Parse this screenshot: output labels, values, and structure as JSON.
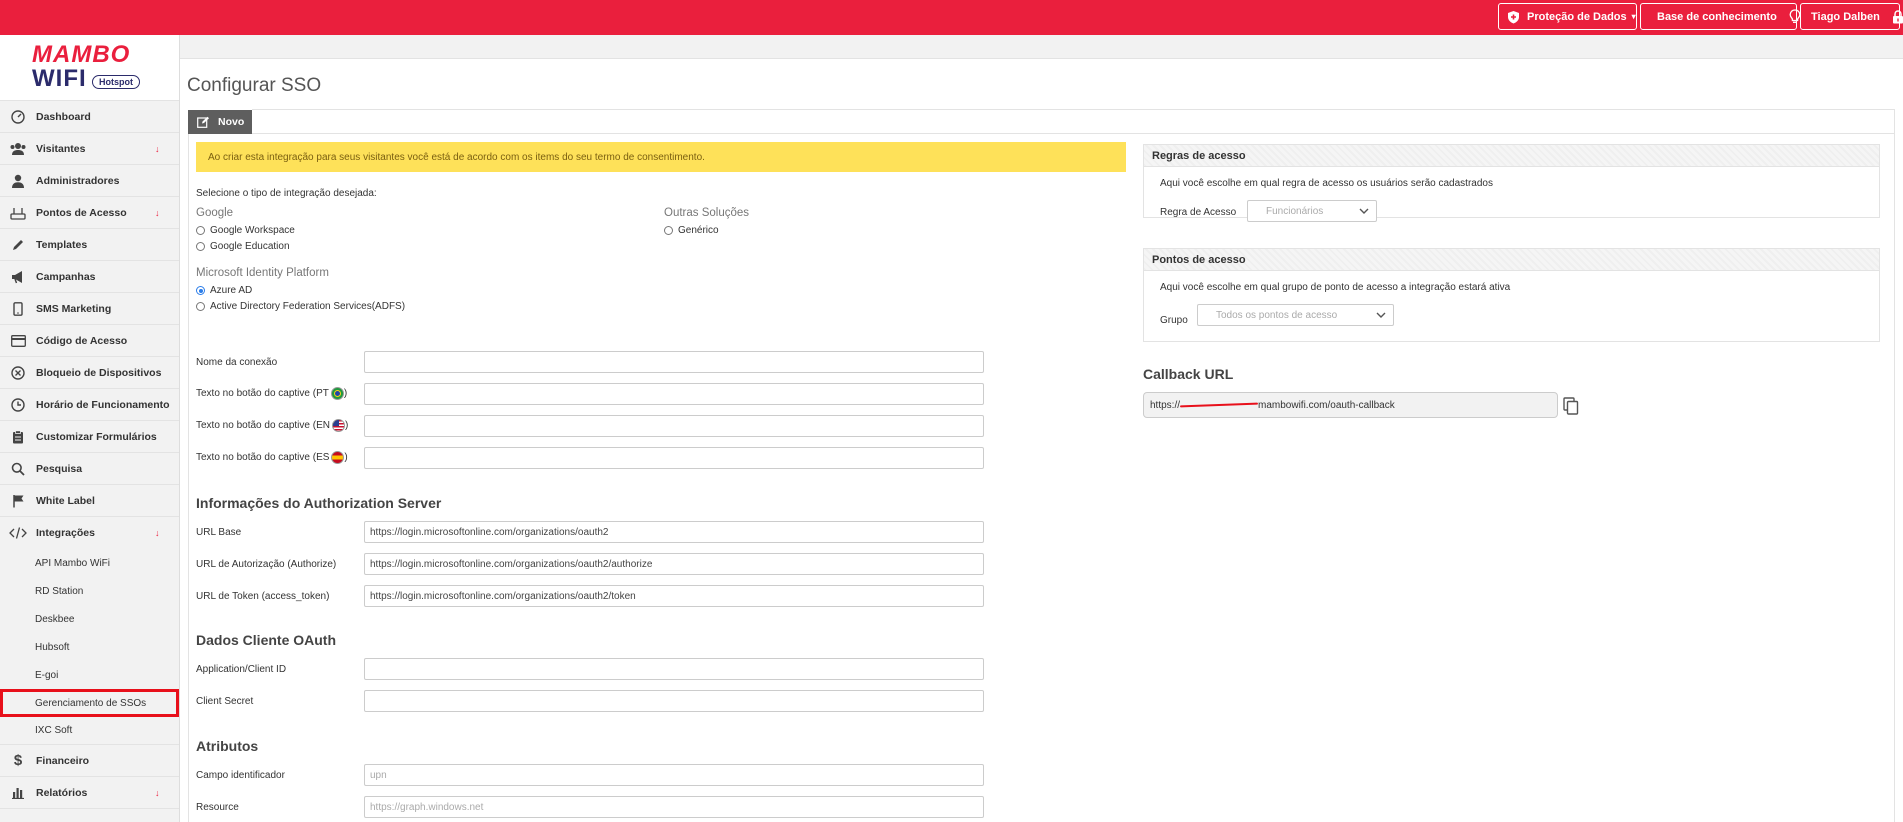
{
  "topbar": {
    "data_protection": "Proteção de Dados",
    "knowledge_base": "Base de conhecimento",
    "user": "Tiago Dalben"
  },
  "brand": {
    "line1": "MAMBO",
    "line2": "WIFI",
    "badge": "Hotspot"
  },
  "sidebar": {
    "items": [
      {
        "label": "Dashboard",
        "icon": "dashboard-icon"
      },
      {
        "label": "Visitantes",
        "icon": "users-icon",
        "arrow": "↓"
      },
      {
        "label": "Administradores",
        "icon": "user-icon"
      },
      {
        "label": "Pontos de Acesso",
        "icon": "router-icon",
        "arrow": "↓"
      },
      {
        "label": "Templates",
        "icon": "pencil-icon"
      },
      {
        "label": "Campanhas",
        "icon": "megaphone-icon"
      },
      {
        "label": "SMS Marketing",
        "icon": "phone-icon"
      },
      {
        "label": "Código de Acesso",
        "icon": "card-icon"
      },
      {
        "label": "Bloqueio de Dispositivos",
        "icon": "block-icon"
      },
      {
        "label": "Horário de Funcionamento",
        "icon": "clock-icon"
      },
      {
        "label": "Customizar Formulários",
        "icon": "clipboard-icon"
      },
      {
        "label": "Pesquisa",
        "icon": "search-icon"
      },
      {
        "label": "White Label",
        "icon": "flag-icon"
      },
      {
        "label": "Integrações",
        "icon": "code-icon",
        "arrow": "↓"
      }
    ],
    "subitems": [
      "API Mambo WiFi",
      "RD Station",
      "Deskbee",
      "Hubsoft",
      "E-goi",
      "Gerenciamento de SSOs",
      "IXC Soft"
    ],
    "bottom_items": [
      {
        "label": "Financeiro",
        "icon": "dollar-icon"
      },
      {
        "label": "Relatórios",
        "icon": "bar-chart-icon",
        "arrow": "↓"
      }
    ]
  },
  "page": {
    "title": "Configurar SSO",
    "tab": "Novo",
    "alert": "Ao criar esta integração para seus visitantes você está de acordo com os items do seu termo de consentimento.",
    "select_type": "Selecione o tipo de integração desejada:",
    "google": {
      "label": "Google",
      "options": [
        "Google Workspace",
        "Google Education"
      ]
    },
    "other": {
      "label": "Outras Soluções",
      "options": [
        "Genérico"
      ]
    },
    "microsoft": {
      "label": "Microsoft Identity Platform",
      "options": [
        "Azure AD",
        "Active Directory Federation Services(ADFS)"
      ],
      "selected": "Azure AD"
    }
  },
  "form": {
    "connection_name": "Nome da conexão",
    "captive_pt": "Texto no botão do captive (PT",
    "captive_en": "Texto no botão do captive (EN",
    "captive_es": "Texto no botão do captive (ES",
    "auth_server_title": "Informações do Authorization Server",
    "base_url_label": "URL Base",
    "base_url": "https://login.microsoftonline.com/organizations/oauth2",
    "authorize_label": "URL de Autorização (Authorize)",
    "authorize_url": "https://login.microsoftonline.com/organizations/oauth2/authorize",
    "token_label": "URL de Token (access_token)",
    "token_url": "https://login.microsoftonline.com/organizations/oauth2/token",
    "oauth_title": "Dados Cliente OAuth",
    "client_id_label": "Application/Client ID",
    "client_secret_label": "Client Secret",
    "attributes_title": "Atributos",
    "identifier_label": "Campo identificador",
    "identifier_placeholder": "upn",
    "resource_label": "Resource",
    "resource_placeholder": "https://graph.windows.net"
  },
  "rules": {
    "title": "Regras de acesso",
    "desc": "Aqui você escolhe em qual regra de acesso os usuários serão cadastrados",
    "label": "Regra de Acesso",
    "value": "Funcionários"
  },
  "points": {
    "title": "Pontos de acesso",
    "desc": "Aqui você escolhe em qual grupo de ponto de acesso a integração estará ativa",
    "label": "Grupo",
    "value": "Todos os pontos de acesso"
  },
  "callback": {
    "title": "Callback URL",
    "prefix": "https://",
    "suffix": "mambowifi.com/oauth-callback"
  },
  "colors": {
    "brand": "#ea1f3d",
    "alert": "#fee159",
    "tab": "#5e5e5e",
    "selected_radio": "#2b7de9"
  }
}
